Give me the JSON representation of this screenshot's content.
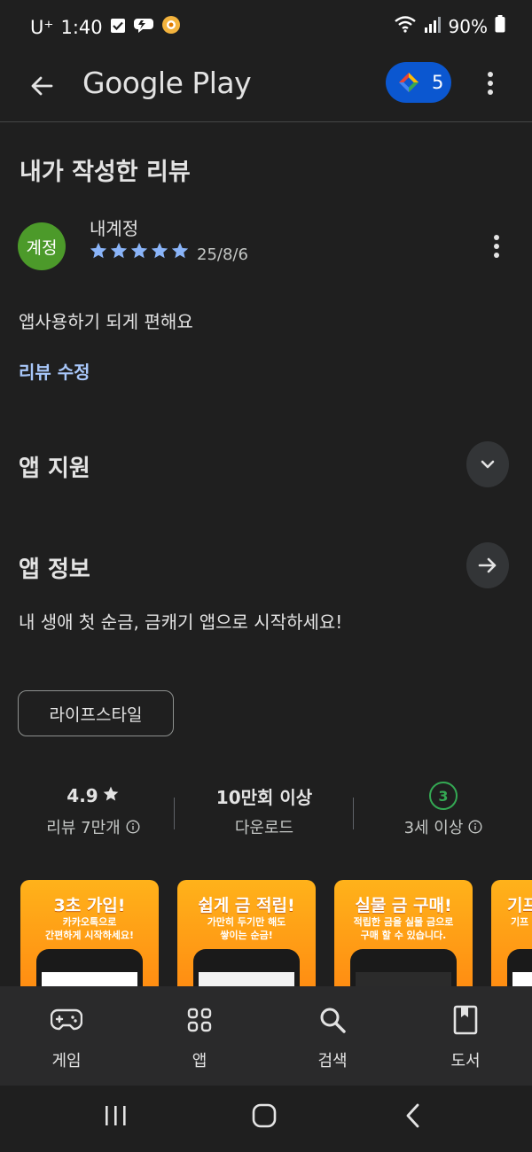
{
  "status_bar": {
    "carrier": "U⁺",
    "time": "1:40",
    "battery": "90%"
  },
  "app_bar": {
    "brand": "Google Play",
    "points_count": "5"
  },
  "review": {
    "section_title": "내가 작성한 리뷰",
    "avatar_text": "계정",
    "reviewer_name": "내계정",
    "stars_filled": 5,
    "date": "25/8/6",
    "body": "앱사용하기 되게 편해요",
    "edit_label": "리뷰 수정"
  },
  "app_support": {
    "title": "앱 지원"
  },
  "app_info": {
    "title": "앱 정보",
    "description": "내 생애 첫 순금, 금캐기 앱으로 시작하세요!",
    "category_chip": "라이프스타일"
  },
  "stats": {
    "rating": "4.9",
    "rating_sub": "리뷰 7만개",
    "downloads": "10만회 이상",
    "downloads_sub": "다운로드",
    "age_badge": "3",
    "age_sub": "3세 이상"
  },
  "screenshots": [
    {
      "title": "3초 가입!",
      "subtitle": "카카오톡으로\n간편하게 시작하세요!"
    },
    {
      "title": "쉽게 금 적립!",
      "subtitle": "가만히 두기만 해도\n쌓이는 순금!"
    },
    {
      "title": "실물 금 구매!",
      "subtitle": "적립한 금을 실물 금으로\n구매 할 수 있습니다."
    },
    {
      "title": "기프",
      "subtitle": "기프"
    }
  ],
  "bottom_nav": {
    "games": "게임",
    "apps": "앱",
    "search": "검색",
    "books": "도서"
  },
  "colors": {
    "background": "#1f1f1f",
    "accent_blue": "#0b57d0",
    "link_blue": "#a8c7fa",
    "star_blue": "#8ab4f8",
    "avatar_green": "#4c9a2a",
    "age_green": "#34a853",
    "screenshot_orange": "#ff9d15"
  }
}
